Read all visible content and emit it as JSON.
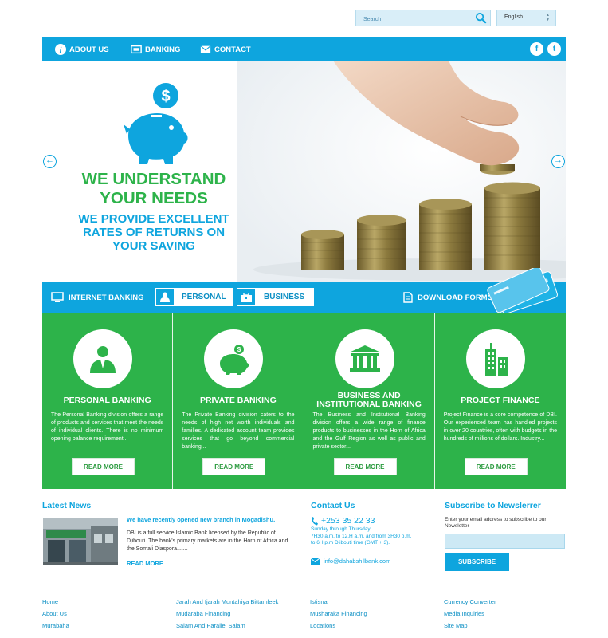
{
  "search": {
    "placeholder": "Search"
  },
  "language": {
    "selected": "English"
  },
  "nav": {
    "items": [
      {
        "label": "ABOUT US"
      },
      {
        "label": "BANKING"
      },
      {
        "label": "CONTACT"
      }
    ],
    "social": {
      "facebook": "f",
      "twitter": "t"
    }
  },
  "hero": {
    "title_line1": "WE UNDERSTAND",
    "title_line2": "YOUR NEEDS",
    "sub_line1": "WE PROVIDE EXCELLENT",
    "sub_line2": "RATES OF RETURNS  ON",
    "sub_line3": "YOUR SAVING",
    "prev_arrow": "←",
    "next_arrow": "→"
  },
  "tabs": {
    "internet_banking": "INTERNET BANKING",
    "personal": "PERSONAL",
    "business": "BUSINESS",
    "download_forms": "DOWNLOAD FORMS"
  },
  "cards": [
    {
      "title": "PERSONAL BANKING",
      "text": "The Personal Banking division offers a range of products and services that meet the needs of individual clients. There is no minimum opening balance requirement...",
      "button": "READ MORE"
    },
    {
      "title": "PRIVATE BANKING",
      "text": "The Private Banking division caters to the needs of high net worth individuals and families. A dedicated account team provides services that go beyond commercial banking...",
      "button": "READ MORE"
    },
    {
      "title": "BUSINESS AND INSTITUTIONAL BANKING",
      "text": "The Business and Institutional Banking division offers a wide range of finance products to businesses in the Horn of Africa and the Gulf Region as well as public and private sector...",
      "button": "READ MORE"
    },
    {
      "title": "PROJECT FINANCE",
      "text": "Project Finance is a core competence of DBI. Our experienced team has handled projects in over 20 countries, often with budgets in the hundreds of millions of dollars. Industry...",
      "button": "READ MORE"
    }
  ],
  "news": {
    "title": "Latest News",
    "headline": "We have recently opened new branch in Mogadishu.",
    "body": "DBI is a full service Islamic Bank licensed by the Republic of Djibouti. The bank's primary markets are in the Horn of Africa and the Somali Diaspora.......",
    "more": "READ MORE"
  },
  "contact": {
    "title": "Contact Us",
    "phone": "+253 35 22 33",
    "hours_line1": "Sunday through Thursday:",
    "hours_line2": "7H30 a.m. to 12.H a.m. and from 3H30 p.m. to 6H p.m Djibouti time (GMT + 3).",
    "email": "info@dahabshilbank.com"
  },
  "newsletter": {
    "title": "Subscribe to Newslerrer",
    "text": "Enter your email address to subscribe to our Newsletter",
    "button": "SUBSCRIBE"
  },
  "footer": {
    "col1": [
      "Home",
      "About Us",
      "Murabaha"
    ],
    "col2": [
      "Jarah And Ijarah Muntahiya Bittamleek",
      "Mudaraba Financing",
      "Salam And Parallel Salam"
    ],
    "col3": [
      "Istisna",
      "Musharaka Financing",
      "Locations"
    ],
    "col4": [
      "Currency Converter",
      "Media Inquiries",
      "Site Map"
    ]
  },
  "colors": {
    "blue": "#0ea5de",
    "green": "#2db34a"
  }
}
